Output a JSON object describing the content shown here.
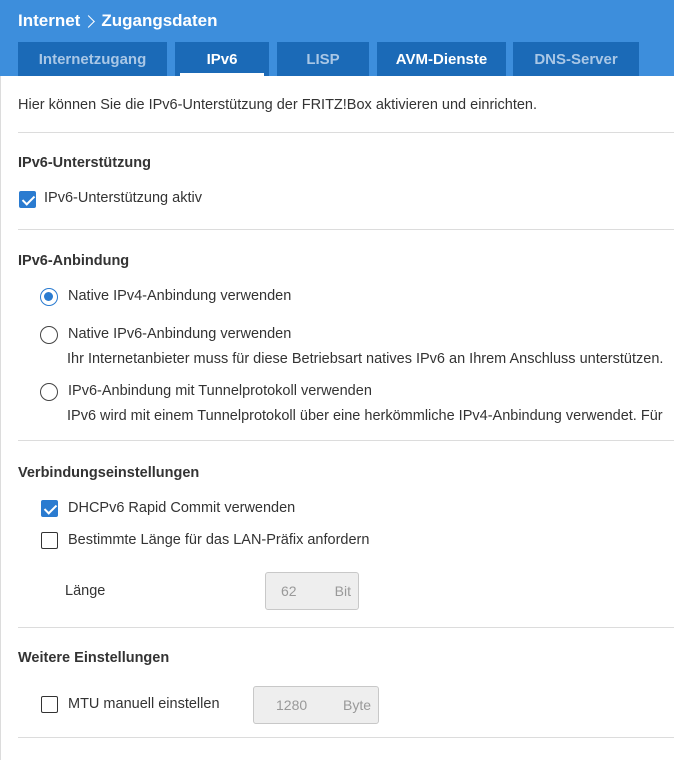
{
  "breadcrumb": {
    "parent": "Internet",
    "current": "Zugangsdaten"
  },
  "tabs": [
    {
      "label": "Internetzugang",
      "active": false
    },
    {
      "label": "IPv6",
      "active": true
    },
    {
      "label": "LISP",
      "active": false
    },
    {
      "label": "AVM-Dienste",
      "active": false
    },
    {
      "label": "DNS-Server",
      "active": false
    }
  ],
  "intro": "Hier können Sie die IPv6-Unterstützung der FRITZ!Box aktivieren und einrichten.",
  "support": {
    "heading": "IPv6-Unterstützung",
    "checkbox_label": "IPv6-Unterstützung aktiv",
    "checked": true
  },
  "binding": {
    "heading": "IPv6-Anbindung",
    "options": [
      {
        "label": "Native IPv4-Anbindung verwenden",
        "selected": true,
        "hint": ""
      },
      {
        "label": "Native IPv6-Anbindung verwenden",
        "selected": false,
        "hint": "Ihr Internetanbieter muss für diese Betriebsart natives IPv6 an Ihrem Anschluss unterstützen."
      },
      {
        "label": "IPv6-Anbindung mit Tunnelprotokoll verwenden",
        "selected": false,
        "hint": "IPv6 wird mit einem Tunnelprotokoll über eine herkömmliche IPv4-Anbindung verwendet. Für"
      }
    ]
  },
  "connection": {
    "heading": "Verbindungseinstellungen",
    "dhcp_label": "DHCPv6 Rapid Commit verwenden",
    "dhcp_checked": true,
    "prefix_label": "Bestimmte Länge für das LAN-Präfix anfordern",
    "prefix_checked": false,
    "length_label": "Länge",
    "length_value": "62",
    "length_unit": "Bit"
  },
  "further": {
    "heading": "Weitere Einstellungen",
    "mtu_label": "MTU manuell einstellen",
    "mtu_checked": false,
    "mtu_value": "1280",
    "mtu_unit": "Byte"
  },
  "colors": {
    "header_bg": "#3d8edc",
    "tab_bg": "#1b6ab7",
    "accent": "#2a7bd0"
  }
}
